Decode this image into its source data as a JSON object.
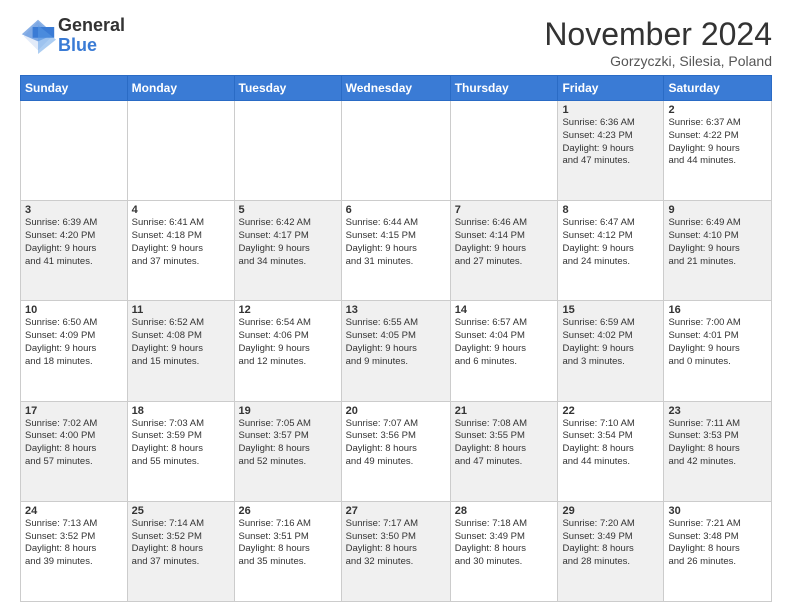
{
  "logo": {
    "general": "General",
    "blue": "Blue"
  },
  "title": "November 2024",
  "location": "Gorzyczki, Silesia, Poland",
  "days_of_week": [
    "Sunday",
    "Monday",
    "Tuesday",
    "Wednesday",
    "Thursday",
    "Friday",
    "Saturday"
  ],
  "weeks": [
    [
      {
        "day": "",
        "info": "",
        "empty": true
      },
      {
        "day": "",
        "info": "",
        "empty": true
      },
      {
        "day": "",
        "info": "",
        "empty": true
      },
      {
        "day": "",
        "info": "",
        "empty": true
      },
      {
        "day": "",
        "info": "",
        "empty": true
      },
      {
        "day": "1",
        "info": "Sunrise: 6:36 AM\nSunset: 4:23 PM\nDaylight: 9 hours\nand 47 minutes.",
        "shaded": true
      },
      {
        "day": "2",
        "info": "Sunrise: 6:37 AM\nSunset: 4:22 PM\nDaylight: 9 hours\nand 44 minutes.",
        "shaded": false
      }
    ],
    [
      {
        "day": "3",
        "info": "Sunrise: 6:39 AM\nSunset: 4:20 PM\nDaylight: 9 hours\nand 41 minutes.",
        "shaded": true
      },
      {
        "day": "4",
        "info": "Sunrise: 6:41 AM\nSunset: 4:18 PM\nDaylight: 9 hours\nand 37 minutes.",
        "shaded": false
      },
      {
        "day": "5",
        "info": "Sunrise: 6:42 AM\nSunset: 4:17 PM\nDaylight: 9 hours\nand 34 minutes.",
        "shaded": true
      },
      {
        "day": "6",
        "info": "Sunrise: 6:44 AM\nSunset: 4:15 PM\nDaylight: 9 hours\nand 31 minutes.",
        "shaded": false
      },
      {
        "day": "7",
        "info": "Sunrise: 6:46 AM\nSunset: 4:14 PM\nDaylight: 9 hours\nand 27 minutes.",
        "shaded": true
      },
      {
        "day": "8",
        "info": "Sunrise: 6:47 AM\nSunset: 4:12 PM\nDaylight: 9 hours\nand 24 minutes.",
        "shaded": false
      },
      {
        "day": "9",
        "info": "Sunrise: 6:49 AM\nSunset: 4:10 PM\nDaylight: 9 hours\nand 21 minutes.",
        "shaded": true
      }
    ],
    [
      {
        "day": "10",
        "info": "Sunrise: 6:50 AM\nSunset: 4:09 PM\nDaylight: 9 hours\nand 18 minutes.",
        "shaded": false
      },
      {
        "day": "11",
        "info": "Sunrise: 6:52 AM\nSunset: 4:08 PM\nDaylight: 9 hours\nand 15 minutes.",
        "shaded": true
      },
      {
        "day": "12",
        "info": "Sunrise: 6:54 AM\nSunset: 4:06 PM\nDaylight: 9 hours\nand 12 minutes.",
        "shaded": false
      },
      {
        "day": "13",
        "info": "Sunrise: 6:55 AM\nSunset: 4:05 PM\nDaylight: 9 hours\nand 9 minutes.",
        "shaded": true
      },
      {
        "day": "14",
        "info": "Sunrise: 6:57 AM\nSunset: 4:04 PM\nDaylight: 9 hours\nand 6 minutes.",
        "shaded": false
      },
      {
        "day": "15",
        "info": "Sunrise: 6:59 AM\nSunset: 4:02 PM\nDaylight: 9 hours\nand 3 minutes.",
        "shaded": true
      },
      {
        "day": "16",
        "info": "Sunrise: 7:00 AM\nSunset: 4:01 PM\nDaylight: 9 hours\nand 0 minutes.",
        "shaded": false
      }
    ],
    [
      {
        "day": "17",
        "info": "Sunrise: 7:02 AM\nSunset: 4:00 PM\nDaylight: 8 hours\nand 57 minutes.",
        "shaded": true
      },
      {
        "day": "18",
        "info": "Sunrise: 7:03 AM\nSunset: 3:59 PM\nDaylight: 8 hours\nand 55 minutes.",
        "shaded": false
      },
      {
        "day": "19",
        "info": "Sunrise: 7:05 AM\nSunset: 3:57 PM\nDaylight: 8 hours\nand 52 minutes.",
        "shaded": true
      },
      {
        "day": "20",
        "info": "Sunrise: 7:07 AM\nSunset: 3:56 PM\nDaylight: 8 hours\nand 49 minutes.",
        "shaded": false
      },
      {
        "day": "21",
        "info": "Sunrise: 7:08 AM\nSunset: 3:55 PM\nDaylight: 8 hours\nand 47 minutes.",
        "shaded": true
      },
      {
        "day": "22",
        "info": "Sunrise: 7:10 AM\nSunset: 3:54 PM\nDaylight: 8 hours\nand 44 minutes.",
        "shaded": false
      },
      {
        "day": "23",
        "info": "Sunrise: 7:11 AM\nSunset: 3:53 PM\nDaylight: 8 hours\nand 42 minutes.",
        "shaded": true
      }
    ],
    [
      {
        "day": "24",
        "info": "Sunrise: 7:13 AM\nSunset: 3:52 PM\nDaylight: 8 hours\nand 39 minutes.",
        "shaded": false
      },
      {
        "day": "25",
        "info": "Sunrise: 7:14 AM\nSunset: 3:52 PM\nDaylight: 8 hours\nand 37 minutes.",
        "shaded": true
      },
      {
        "day": "26",
        "info": "Sunrise: 7:16 AM\nSunset: 3:51 PM\nDaylight: 8 hours\nand 35 minutes.",
        "shaded": false
      },
      {
        "day": "27",
        "info": "Sunrise: 7:17 AM\nSunset: 3:50 PM\nDaylight: 8 hours\nand 32 minutes.",
        "shaded": true
      },
      {
        "day": "28",
        "info": "Sunrise: 7:18 AM\nSunset: 3:49 PM\nDaylight: 8 hours\nand 30 minutes.",
        "shaded": false
      },
      {
        "day": "29",
        "info": "Sunrise: 7:20 AM\nSunset: 3:49 PM\nDaylight: 8 hours\nand 28 minutes.",
        "shaded": true
      },
      {
        "day": "30",
        "info": "Sunrise: 7:21 AM\nSunset: 3:48 PM\nDaylight: 8 hours\nand 26 minutes.",
        "shaded": false
      }
    ]
  ]
}
